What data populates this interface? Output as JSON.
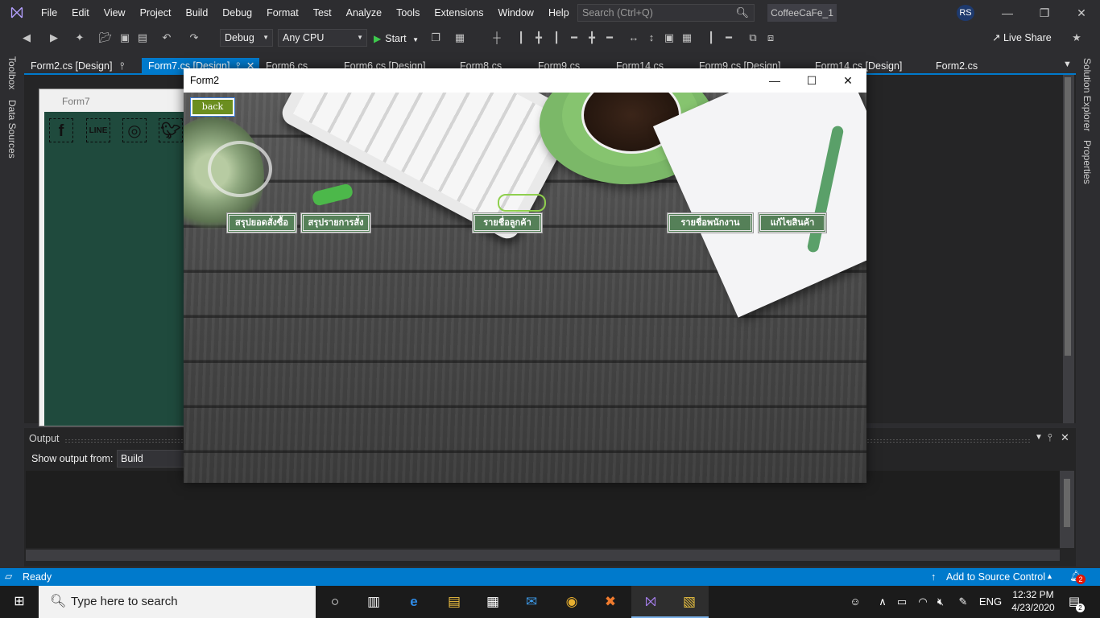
{
  "menu": {
    "items": [
      "File",
      "Edit",
      "View",
      "Project",
      "Build",
      "Debug",
      "Format",
      "Test",
      "Analyze",
      "Tools",
      "Extensions",
      "Window",
      "Help"
    ],
    "search_placeholder": "Search (Ctrl+Q)",
    "solution_name": "CoffeeCaFe_1",
    "user_initials": "RS"
  },
  "toolbar": {
    "config": "Debug",
    "platform": "Any CPU",
    "start_label": "Start",
    "live_share_label": "Live Share"
  },
  "side_panels": {
    "left": [
      "Toolbox",
      "Data Sources"
    ],
    "right": [
      "Solution Explorer",
      "Properties"
    ]
  },
  "tabs": [
    {
      "label": "Form2.cs [Design]"
    },
    {
      "label": "Form7.cs [Design]"
    },
    {
      "label": "Form6.cs"
    },
    {
      "label": "Form6.cs [Design]"
    },
    {
      "label": "Form8.cs"
    },
    {
      "label": "Form9.cs"
    },
    {
      "label": "Form14.cs"
    },
    {
      "label": "Form9.cs [Design]"
    },
    {
      "label": "Form14.cs [Design]"
    },
    {
      "label": "Form2.cs"
    }
  ],
  "designer": {
    "form_title": "Form7",
    "social_icons": [
      "facebook-icon",
      "line-icon",
      "instagram-icon",
      "twitter-icon"
    ]
  },
  "output": {
    "title": "Output",
    "show_from_label": "Show output from:",
    "source": "Build"
  },
  "statusbar": {
    "state": "Ready",
    "source_control": "Add to Source Control",
    "notifications": "2"
  },
  "form2": {
    "title": "Form2",
    "back_button": "back",
    "buttons": [
      "สรุปยอดสั่งซื้อ",
      "สรุปรายการสั่ง",
      "รายชื่อลูกค้า",
      "รายชื่อพนักงาน",
      "แก้ไขสินค้า"
    ]
  },
  "taskbar": {
    "search_placeholder": "Type here to search",
    "language": "ENG",
    "time": "12:32 PM",
    "date": "4/23/2020",
    "notification_count": "2"
  }
}
